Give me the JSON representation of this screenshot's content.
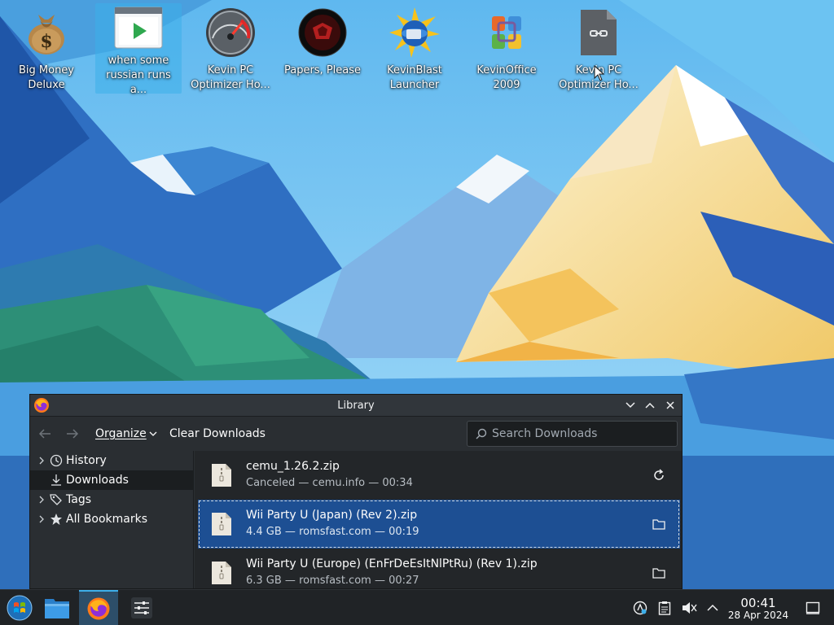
{
  "desktop": {
    "icons": [
      {
        "label": "Big Money\nDeluxe",
        "icon": "money-bag-icon"
      },
      {
        "label": "when some\nrussian runs a...",
        "icon": "video-play-icon"
      },
      {
        "label": "Kevin PC\nOptimizer Ho...",
        "icon": "speedometer-icon"
      },
      {
        "label": "Papers, Please",
        "icon": "papers-please-icon"
      },
      {
        "label": "KevinBlast\nLauncher",
        "icon": "kevinblast-icon"
      },
      {
        "label": "KevinOffice\n2009",
        "icon": "office-logo-icon"
      },
      {
        "label": "Kevin PC\nOptimizer Ho...",
        "icon": "generic-file-icon"
      }
    ]
  },
  "library": {
    "title": "Library",
    "toolbar": {
      "organize_label": "Organize",
      "clear_label": "Clear Downloads",
      "search_placeholder": "Search Downloads"
    },
    "sidebar": [
      {
        "label": "History",
        "icon": "clock-icon",
        "expandable": true
      },
      {
        "label": "Downloads",
        "icon": "download-icon",
        "expandable": false,
        "active": true
      },
      {
        "label": "Tags",
        "icon": "tags-icon",
        "expandable": true
      },
      {
        "label": "All Bookmarks",
        "icon": "star-icon",
        "expandable": true
      }
    ],
    "downloads": [
      {
        "name": "cemu_1.26.2.zip",
        "meta": "Canceled — cemu.info — 00:34",
        "action": "retry-icon"
      },
      {
        "name": "Wii Party U (Japan) (Rev 2).zip",
        "meta": "4.4 GB — romsfast.com — 00:19",
        "action": "folder-icon",
        "selected": true
      },
      {
        "name": "Wii Party U (Europe) (EnFrDeEsItNlPtRu) (Rev 1).zip",
        "meta": "6.3 GB — romsfast.com — 00:27",
        "action": "folder-icon"
      }
    ]
  },
  "taskbar": {
    "apps": [
      "start-menu-icon",
      "file-manager-icon",
      "firefox-icon",
      "settings-sliders-icon"
    ],
    "active_app": "firefox-icon",
    "tray": [
      "network-icon",
      "clipboard-icon",
      "volume-muted-icon",
      "tray-expand-icon"
    ],
    "time": "00:41",
    "date": "28 Apr 2024"
  },
  "colors": {
    "accent": "#3daee9",
    "selection": "#1d4f93",
    "window_bg": "#2a2e32",
    "list_bg": "#232629"
  }
}
